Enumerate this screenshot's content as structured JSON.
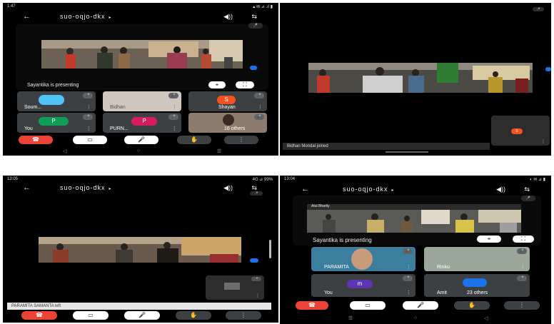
{
  "meeting": {
    "code": "suo-oqjo-dkx"
  },
  "icons": {
    "back": "←",
    "caret": "▸",
    "speaker": "◀))",
    "camera_switch": "⇆",
    "end_call": "☎",
    "camera": "▭",
    "mic": "🎤",
    "raise_hand": "✋",
    "more": "⋮",
    "pin": "⌖",
    "screen": "⛶",
    "nav_back": "◁",
    "nav_home": "○",
    "nav_recent": "☰"
  },
  "colors": {
    "end_call": "#ea4335",
    "avatar_blue": "#1a73e8",
    "avatar_green": "#0f9d58",
    "avatar_pink": "#d81b60",
    "avatar_orange": "#f4511e",
    "avatar_purple": "#5e35b1"
  },
  "panel1": {
    "status_time": "1:47",
    "presenting": "Sayantika is presenting",
    "tiles": [
      {
        "name": "Soum..."
      },
      {
        "name": "Bidhan"
      },
      {
        "name": "Shayan",
        "initial": "S"
      },
      {
        "name": "You",
        "initial": "P"
      },
      {
        "name": "PURN...",
        "initial": "P"
      },
      {
        "name": "16 others"
      }
    ]
  },
  "panel2": {
    "toast": "Bidhan Mondal joined",
    "self_initial": "S"
  },
  "panel3": {
    "status_time": "13:05",
    "status_right": "4G ⊿ 99%",
    "toast": "PARAMITA SAMANTA left"
  },
  "panel4": {
    "status_time": "13:04",
    "presenting": "Sayantika is presenting",
    "shared_caption": "Atul Bhartiy",
    "tiles": [
      {
        "name": "PARAMITA"
      },
      {
        "name": "Rinku"
      },
      {
        "name": "You",
        "initial": "m"
      },
      {
        "name": "Amit",
        "others": "23 others"
      }
    ]
  }
}
